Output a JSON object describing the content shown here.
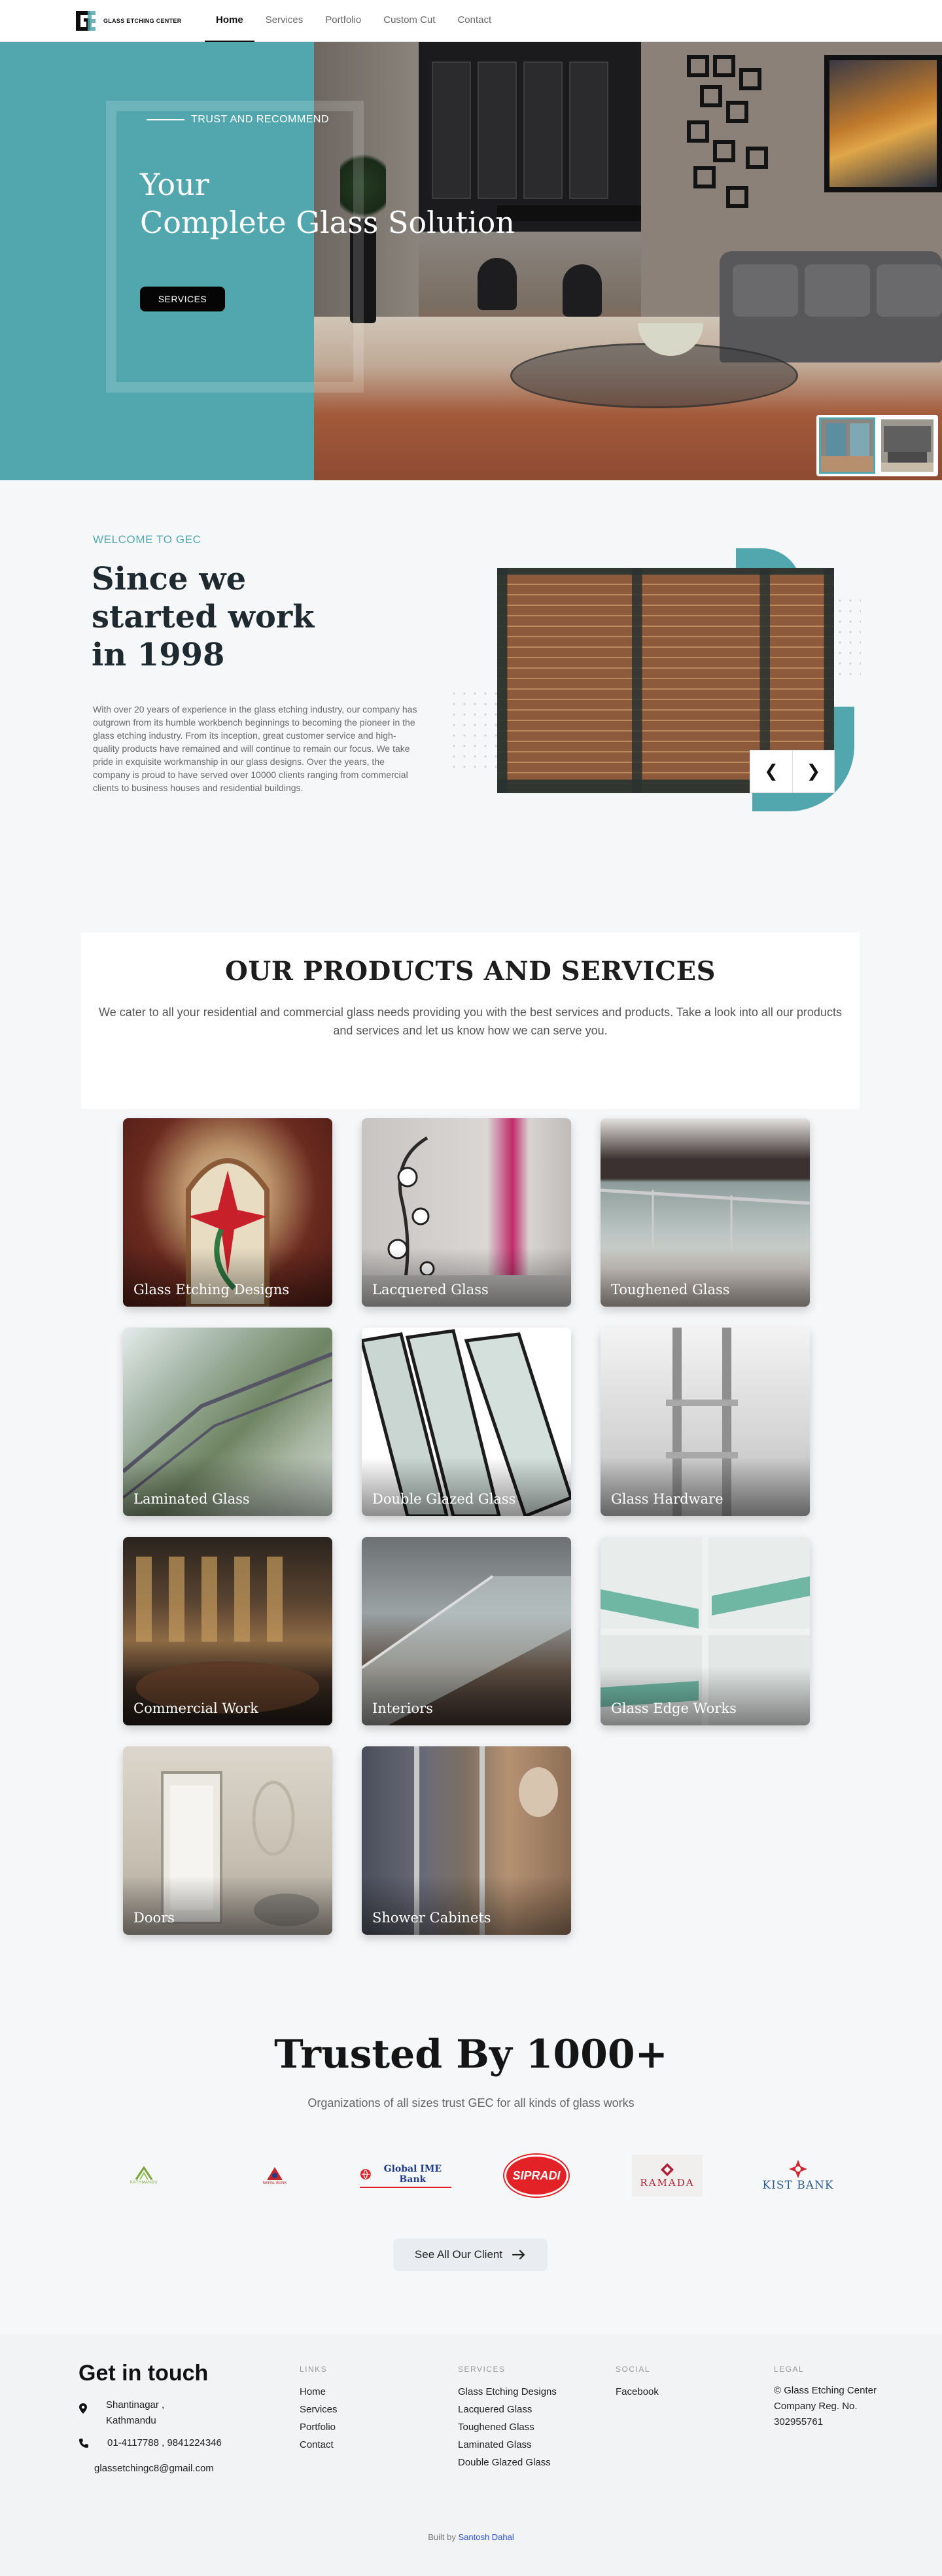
{
  "brand": {
    "name": "GLASS ETCHING CENTER",
    "logo_letters": "GEC"
  },
  "nav": {
    "items": [
      {
        "label": "Home",
        "active": true
      },
      {
        "label": "Services"
      },
      {
        "label": "Portfolio"
      },
      {
        "label": "Custom Cut"
      },
      {
        "label": "Contact"
      }
    ]
  },
  "hero": {
    "kicker": "TRUST AND RECOMMEND",
    "title_line1": "Your",
    "title_line2": "Complete Glass Solution",
    "button": "SERVICES",
    "accent": "#52a6ae",
    "selected_thumb": 1
  },
  "welcome": {
    "kicker": "WELCOME TO GEC",
    "title_line1": "Since we",
    "title_line2": "started work",
    "title_line3": "in 1998",
    "text": "With over 20 years of experience in the glass etching industry, our company has outgrown from its humble workbench beginnings to becoming the pioneer in the glass etching industry. From its inception, great customer service and high-quality products have remained and will continue to remain our focus. We take pride in exquisite workmanship in our glass designs. Over the years, the company is proud to have served over 10000 clients ranging from commercial clients to business houses and residential buildings.",
    "prev": "❮",
    "next": "❯"
  },
  "products": {
    "title": "OUR PRODUCTS AND SERVICES",
    "subtitle": "We cater to all your residential and commercial glass needs providing you with the best services and products. Take a look into all our products and services and let us know how we can serve you.",
    "items": [
      {
        "label": "Glass Etching Designs"
      },
      {
        "label": "Lacquered Glass"
      },
      {
        "label": "Toughened Glass"
      },
      {
        "label": "Laminated Glass"
      },
      {
        "label": "Double Glazed Glass"
      },
      {
        "label": "Glass Hardware"
      },
      {
        "label": "Commercial Work"
      },
      {
        "label": "Interiors"
      },
      {
        "label": "Glass Edge Works"
      },
      {
        "label": "Doors"
      },
      {
        "label": "Shower Cabinets"
      }
    ]
  },
  "trusted": {
    "title": "Trusted By 1000+",
    "subtitle": "Organizations of all sizes trust GEC for all kinds of glass works",
    "clients": [
      {
        "name": "KATHMANDU",
        "color": "#7aa33a"
      },
      {
        "name": "NEPAL BANK",
        "color": "#c0282d"
      },
      {
        "name": "Global IME Bank",
        "color": "#1f3d8a"
      },
      {
        "name": "SIPRADI",
        "color": "#e32227"
      },
      {
        "name": "RAMADA",
        "color": "#b32035"
      },
      {
        "name": "KIST BANK",
        "color": "#2d5e8e"
      }
    ],
    "button": "See All Our Client",
    "button_icon": "arrow-right-icon"
  },
  "footer": {
    "title": "Get in touch",
    "address": "Shantinagar ,\nKathmandu",
    "phone": "01-4117788 , 9841224346",
    "email": "glassetchingc8@gmail.com",
    "links_head": "LINKS",
    "links": [
      "Home",
      "Services",
      "Portfolio",
      "Contact"
    ],
    "services_head": "SERVICES",
    "services": [
      "Glass Etching Designs",
      "Lacquered Glass",
      "Toughened Glass",
      "Laminated Glass",
      "Double Glazed Glass"
    ],
    "social_head": "SOCIAL",
    "social": [
      "Facebook"
    ],
    "legal_head": "LEGAL",
    "legal": "© Glass Etching Center Company Reg. No. 302955761",
    "built_prefix": "Built by ",
    "built_name": "Santosh Dahal"
  }
}
